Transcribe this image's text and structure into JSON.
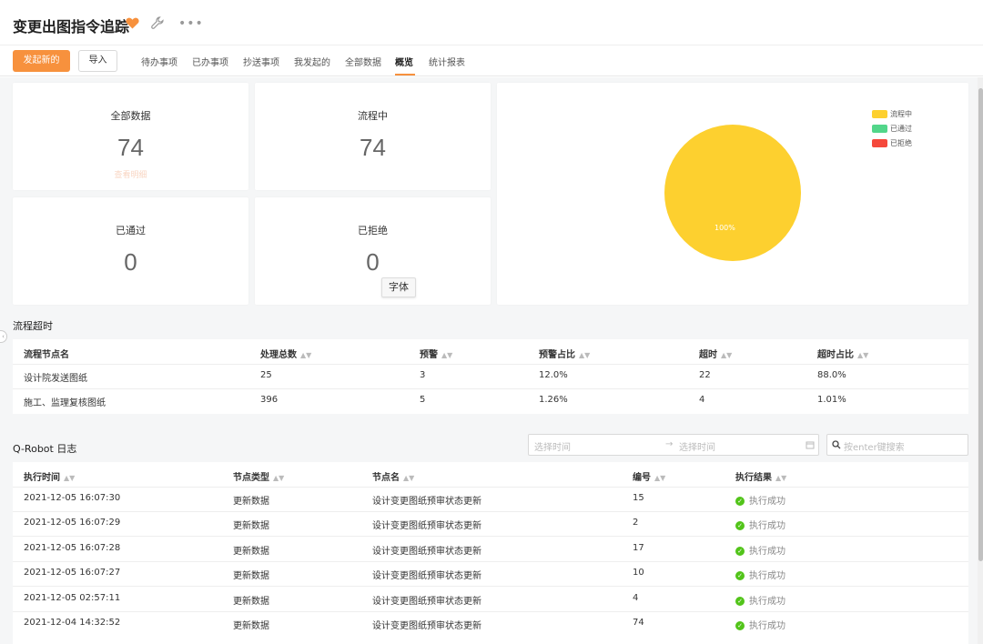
{
  "app": {
    "title": "变更出图指令追踪"
  },
  "toolbar": {
    "new_button": "发起新的",
    "import_button": "导入",
    "tabs": [
      "待办事项",
      "已办事项",
      "抄送事项",
      "我发起的",
      "全部数据",
      "概览",
      "统计报表"
    ],
    "active_tab": "概览"
  },
  "stats": {
    "all": {
      "label": "全部数据",
      "value": "74",
      "link": "查看明细"
    },
    "in_process": {
      "label": "流程中",
      "value": "74"
    },
    "approved": {
      "label": "已通过",
      "value": "0"
    },
    "rejected": {
      "label": "已拒绝",
      "value": "0"
    }
  },
  "tooltip": "字体",
  "chart_data": {
    "type": "pie",
    "slices": [
      {
        "name": "流程中",
        "value": 74,
        "color": "#fdd02f"
      },
      {
        "name": "已通过",
        "value": 0,
        "color": "#52d68a"
      },
      {
        "name": "已拒绝",
        "value": 0,
        "color": "#f5483b"
      }
    ],
    "data_label": "100%",
    "legend_position": "top-right"
  },
  "timeout": {
    "title": "流程超时",
    "headers": [
      "流程节点名",
      "处理总数",
      "预警",
      "预警占比",
      "超时",
      "超时占比"
    ],
    "rows": [
      [
        "设计院发送图纸",
        "25",
        "3",
        "12.0%",
        "22",
        "88.0%"
      ],
      [
        "施工、监理复核图纸",
        "396",
        "5",
        "1.26%",
        "4",
        "1.01%"
      ]
    ]
  },
  "log": {
    "title": "Q-Robot 日志",
    "start_placeholder": "选择时间",
    "end_placeholder": "选择时间",
    "range_separator": "→",
    "search_placeholder": "按enter键搜索",
    "headers": [
      "执行时间",
      "节点类型",
      "节点名",
      "编号",
      "执行结果"
    ],
    "rows": [
      [
        "2021-12-05 16:07:30",
        "更新数据",
        "设计变更图纸预审状态更新",
        "15",
        "执行成功"
      ],
      [
        "2021-12-05 16:07:29",
        "更新数据",
        "设计变更图纸预审状态更新",
        "2",
        "执行成功"
      ],
      [
        "2021-12-05 16:07:28",
        "更新数据",
        "设计变更图纸预审状态更新",
        "17",
        "执行成功"
      ],
      [
        "2021-12-05 16:07:27",
        "更新数据",
        "设计变更图纸预审状态更新",
        "10",
        "执行成功"
      ],
      [
        "2021-12-05 02:57:11",
        "更新数据",
        "设计变更图纸预审状态更新",
        "4",
        "执行成功"
      ],
      [
        "2021-12-04 14:32:52",
        "更新数据",
        "设计变更图纸预审状态更新",
        "74",
        "执行成功"
      ]
    ]
  },
  "colors": {
    "accent": "#f7913d",
    "success": "#52c41a",
    "pie_main": "#fdd02f"
  }
}
